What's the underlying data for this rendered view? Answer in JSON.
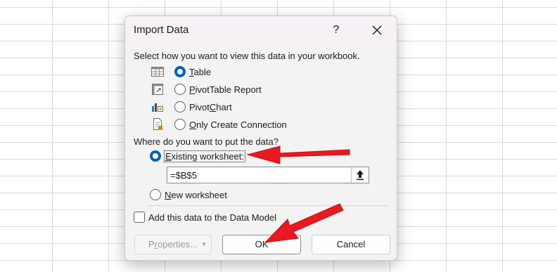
{
  "dialog": {
    "title": "Import Data",
    "help_label": "?",
    "close_label": "close",
    "view_prompt": "Select how you want to view this data in your workbook.",
    "view_options": [
      {
        "label": "Table",
        "mnemonic": "T",
        "rest": "able",
        "selected": true
      },
      {
        "label": "PivotTable Report",
        "mnemonic": "P",
        "rest": "ivotTable Report",
        "selected": false
      },
      {
        "label": "PivotChart",
        "prefix": "Pivot",
        "mnemonic": "C",
        "rest": "hart",
        "selected": false
      },
      {
        "label": "Only Create Connection",
        "mnemonic": "O",
        "rest": "nly Create Connection",
        "selected": false
      }
    ],
    "location_prompt": "Where do you want to put the data?",
    "existing_worksheet": {
      "label": "Existing worksheet:",
      "mnemonic": "E",
      "rest": "xisting worksheet:",
      "selected": true
    },
    "cell_reference": "=$B$5",
    "new_worksheet": {
      "label": "New worksheet",
      "mnemonic": "N",
      "rest": "ew worksheet",
      "selected": false
    },
    "data_model_checkbox": {
      "label": "Add this data to the Data Model",
      "mnemonic": "M",
      "checked": false
    },
    "buttons": {
      "properties": {
        "label": "Properties...",
        "prefix": "P",
        "mnemonic": "r",
        "rest": "operties...",
        "enabled": false
      },
      "ok": "OK",
      "cancel": "Cancel"
    }
  },
  "annotations": {
    "arrow_color": "#e8191f"
  },
  "colors": {
    "accent": "#005fb8",
    "titlebar": "#f7f1f6",
    "dialog_bg": "#f3f3f3"
  }
}
